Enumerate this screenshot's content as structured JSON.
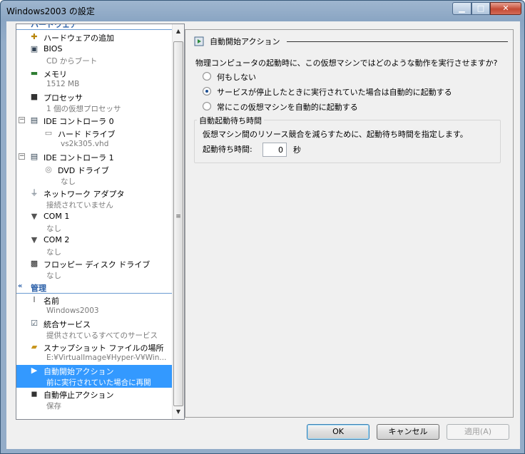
{
  "window": {
    "title": "Windows2003 の設定"
  },
  "colors": {
    "selection": "#3399ff",
    "section_heading": "#2a5fa8"
  },
  "tree": {
    "section_hardware_partial": "ハードウェア",
    "items": [
      {
        "label": "ハードウェアの追加",
        "sub": "",
        "icon": "add-hardware-icon"
      },
      {
        "label": "BIOS",
        "sub": "CD からブート",
        "icon": "bios-icon"
      },
      {
        "label": "メモリ",
        "sub": "1512 MB",
        "icon": "memory-icon"
      },
      {
        "label": "プロセッサ",
        "sub": "1 個の仮想プロセッサ",
        "icon": "processor-icon"
      },
      {
        "label": "IDE コントローラ 0",
        "sub": "",
        "icon": "ide-controller-icon"
      },
      {
        "label": "ハード ドライブ",
        "sub": "vs2k305.vhd",
        "icon": "hard-drive-icon"
      },
      {
        "label": "IDE コントローラ 1",
        "sub": "",
        "icon": "ide-controller-icon"
      },
      {
        "label": "DVD ドライブ",
        "sub": "なし",
        "icon": "dvd-icon"
      },
      {
        "label": "ネットワーク アダプタ",
        "sub": "接続されていません",
        "icon": "network-adapter-icon"
      },
      {
        "label": "COM 1",
        "sub": "なし",
        "icon": "com-port-icon"
      },
      {
        "label": "COM 2",
        "sub": "なし",
        "icon": "com-port-icon"
      },
      {
        "label": "フロッピー ディスク ドライブ",
        "sub": "なし",
        "icon": "floppy-icon"
      }
    ],
    "section_management": "管理",
    "management_items": [
      {
        "label": "名前",
        "sub": "Windows2003",
        "icon": "name-icon"
      },
      {
        "label": "統合サービス",
        "sub": "提供されているすべてのサービス",
        "icon": "integration-services-icon"
      },
      {
        "label": "スナップショット ファイルの場所",
        "sub": "E:¥VirtualImage¥Hyper-V¥Win...",
        "icon": "snapshot-folder-icon"
      },
      {
        "label": "自動開始アクション",
        "sub": "前に実行されていた場合に再開",
        "icon": "auto-start-icon",
        "selected": true
      },
      {
        "label": "自動停止アクション",
        "sub": "保存",
        "icon": "auto-stop-icon"
      }
    ]
  },
  "page": {
    "header": "自動開始アクション",
    "question": "物理コンピュータの起動時に、この仮想マシンではどのような動作を実行させますか?",
    "options": [
      {
        "label": "何もしない",
        "checked": false
      },
      {
        "label": "サービスが停止したときに実行されていた場合は自動的に起動する",
        "checked": true
      },
      {
        "label": "常にこの仮想マシンを自動的に起動する",
        "checked": false
      }
    ],
    "delay_group": {
      "title": "自動起動待ち時間",
      "description": "仮想マシン間のリソース競合を減らすために、起動待ち時間を指定します。",
      "label": "起動待ち時間:",
      "value": "0",
      "unit": "秒"
    }
  },
  "buttons": {
    "ok": "OK",
    "cancel": "キャンセル",
    "apply": "適用(A)"
  }
}
